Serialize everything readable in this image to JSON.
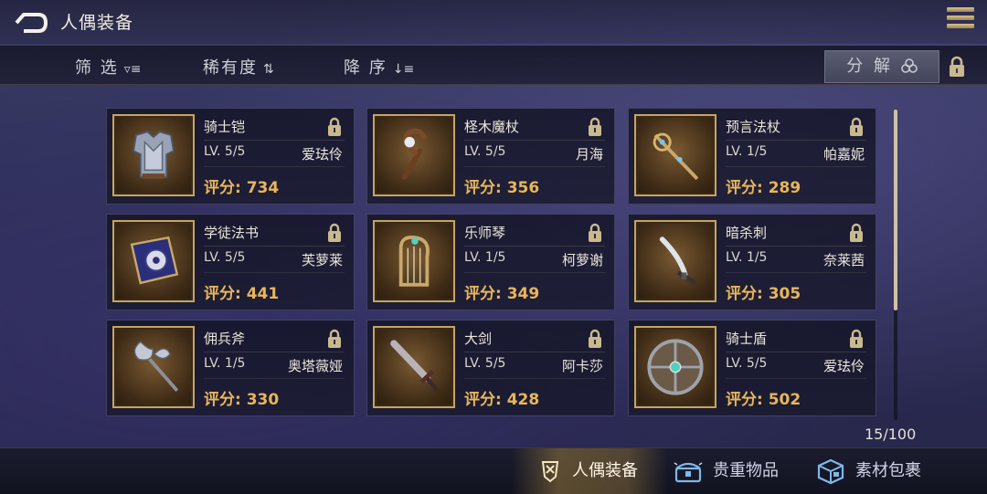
{
  "header": {
    "title": "人偶装备"
  },
  "filterbar": {
    "filter_label": "筛 选",
    "filter_icon": "▿≡",
    "rarity_label": "稀有度",
    "rarity_icon": "⇅",
    "order_label": "降 序",
    "order_icon": "↓≡",
    "decompose_label": "分 解"
  },
  "items": [
    {
      "name": "骑士铠",
      "level": "LV. 5/5",
      "owner": "爱珐伶",
      "score": "评分: 734",
      "icon": "knight-armor-icon"
    },
    {
      "name": "柽木魔杖",
      "level": "LV. 5/5",
      "owner": "月海",
      "score": "评分: 356",
      "icon": "wooden-wand-icon"
    },
    {
      "name": "预言法杖",
      "level": "LV. 1/5",
      "owner": "帕嘉妮",
      "score": "评分: 289",
      "icon": "prophecy-staff-icon"
    },
    {
      "name": "学徒法书",
      "level": "LV. 5/5",
      "owner": "芙萝莱",
      "score": "评分: 441",
      "icon": "spellbook-icon"
    },
    {
      "name": "乐师琴",
      "level": "LV. 1/5",
      "owner": "柯萝谢",
      "score": "评分: 349",
      "icon": "harp-icon"
    },
    {
      "name": "暗杀刺",
      "level": "LV. 1/5",
      "owner": "奈莱茜",
      "score": "评分: 305",
      "icon": "dagger-icon"
    },
    {
      "name": "佣兵斧",
      "level": "LV. 1/5",
      "owner": "奥塔薇娅",
      "score": "评分: 330",
      "icon": "battle-axe-icon"
    },
    {
      "name": "大剑",
      "level": "LV. 5/5",
      "owner": "阿卡莎",
      "score": "评分: 428",
      "icon": "greatsword-icon"
    },
    {
      "name": "骑士盾",
      "level": "LV. 5/5",
      "owner": "爱珐伶",
      "score": "评分: 502",
      "icon": "round-shield-icon"
    }
  ],
  "inventory_count": "15/100",
  "bottom_tabs": [
    {
      "label": "人偶装备",
      "icon": "armor-tab-icon",
      "active": true
    },
    {
      "label": "贵重物品",
      "icon": "treasure-chest-icon",
      "active": false
    },
    {
      "label": "素材包裹",
      "icon": "material-box-icon",
      "active": false
    }
  ],
  "colors": {
    "gold": "#c6a462",
    "score": "#e8b65a"
  }
}
